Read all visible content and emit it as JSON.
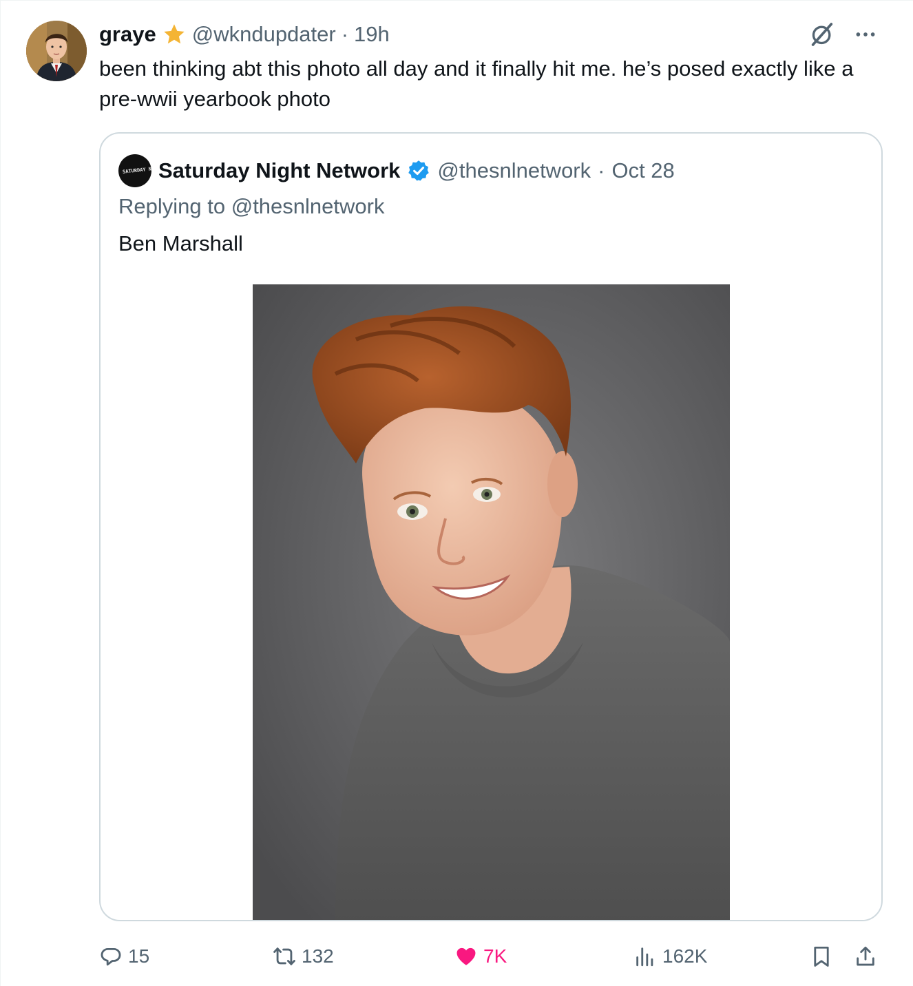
{
  "tweet": {
    "display_name": "graye",
    "handle": "@wkndupdater",
    "separator": "·",
    "time": "19h",
    "text": "been thinking abt this photo all day and it finally hit me. he’s posed exactly like a pre-wwii yearbook photo"
  },
  "quoted": {
    "avatar_text": "SATURDAY NIGHT NETWORK",
    "display_name": "Saturday Night Network",
    "handle": "@thesnlnetwork",
    "separator": "·",
    "date": "Oct 28",
    "replying_prefix": "Replying to",
    "replying_mention": "@thesnlnetwork",
    "text": "Ben Marshall"
  },
  "actions": {
    "replies": "15",
    "reposts": "132",
    "likes": "7K",
    "views": "162K"
  },
  "colors": {
    "text": "#0f1419",
    "secondary": "#536471",
    "like": "#f91880",
    "verified": "#1d9bf0",
    "star": "#f4b434",
    "border": "#cfd9de"
  },
  "icons": {
    "star": "gold-star-icon",
    "verified": "verified-badge-icon",
    "grok": "grok-icon",
    "more": "more-icon",
    "reply": "reply-icon",
    "repost": "repost-icon",
    "like": "heart-icon",
    "views": "views-icon",
    "bookmark": "bookmark-icon",
    "share": "share-icon"
  }
}
